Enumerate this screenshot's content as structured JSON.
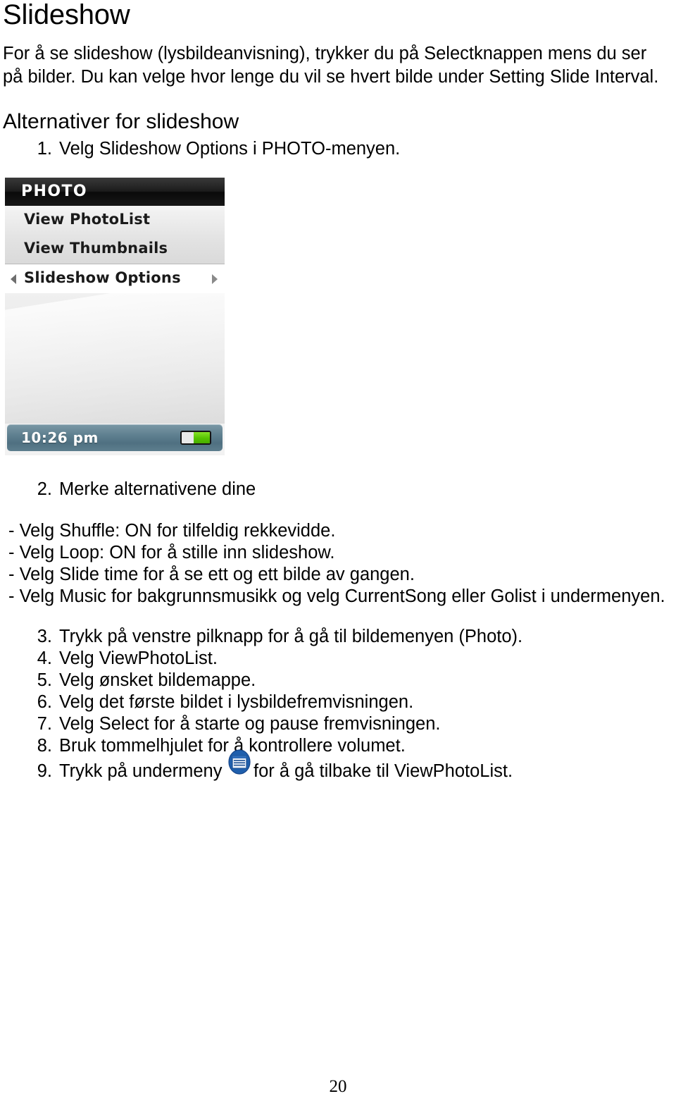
{
  "document": {
    "title": "Slideshow",
    "intro": "For å se slideshow (lysbildeanvisning), trykker du på Selectknappen mens du ser på bilder. Du kan velge hvor lenge du vil se hvert bilde under Setting Slide Interval.",
    "section_heading": "Alternativer for slideshow",
    "page_number": "20"
  },
  "steps": {
    "step1": {
      "num": "1.",
      "text": "Velg Slideshow Options i PHOTO-menyen."
    },
    "step2": {
      "num": "2.",
      "text": "Merke alternativene dine"
    },
    "step3": {
      "num": "3.",
      "text": "Trykk på venstre pilknapp for å gå til bildemenyen (Photo)."
    },
    "step4": {
      "num": "4.",
      "text": "Velg ViewPhotoList."
    },
    "step5": {
      "num": "5.",
      "text": "Velg ønsket bildemappe."
    },
    "step6": {
      "num": "6.",
      "text": "Velg det første bildet i lysbildefremvisningen."
    },
    "step7": {
      "num": "7.",
      "text": "Velg Select for å starte og pause fremvisningen."
    },
    "step8": {
      "num": "8.",
      "text": "Bruk tommelhjulet for å kontrollere volumet."
    },
    "step9": {
      "num": "9.",
      "text_before": "Trykk på undermeny",
      "icon": "submenu-list-icon",
      "text_after": "for å gå tilbake til ViewPhotoList."
    }
  },
  "bullets": [
    "- Velg Shuffle: ON for tilfeldig rekkevidde.",
    "- Velg Loop: ON for å stille inn slideshow.",
    "- Velg Slide time for å se ett og ett bilde av gangen.",
    "- Velg Music for bakgrunnsmusikk og velg CurrentSong eller Golist i undermenyen."
  ],
  "device_screenshot": {
    "titlebar": "PHOTO",
    "menu_items": [
      {
        "label": "View PhotoList",
        "selected": false
      },
      {
        "label": "View Thumbnails",
        "selected": false
      },
      {
        "label": "Slideshow Options",
        "selected": true
      }
    ],
    "left_arrow_icon": "triangle-left-icon",
    "right_arrow_icon": "triangle-right-icon",
    "status_time": "10:26 pm",
    "battery_icon": "battery-icon",
    "colors": {
      "titlebar_bg": "#141414",
      "status_bg": "#5f8090",
      "battery_fill": "#55c400",
      "selected_row_bg": "#ffffff"
    }
  },
  "icon_colors": {
    "submenu_icon_circle": "#1f5fad",
    "submenu_icon_page": "#e8eef6"
  }
}
